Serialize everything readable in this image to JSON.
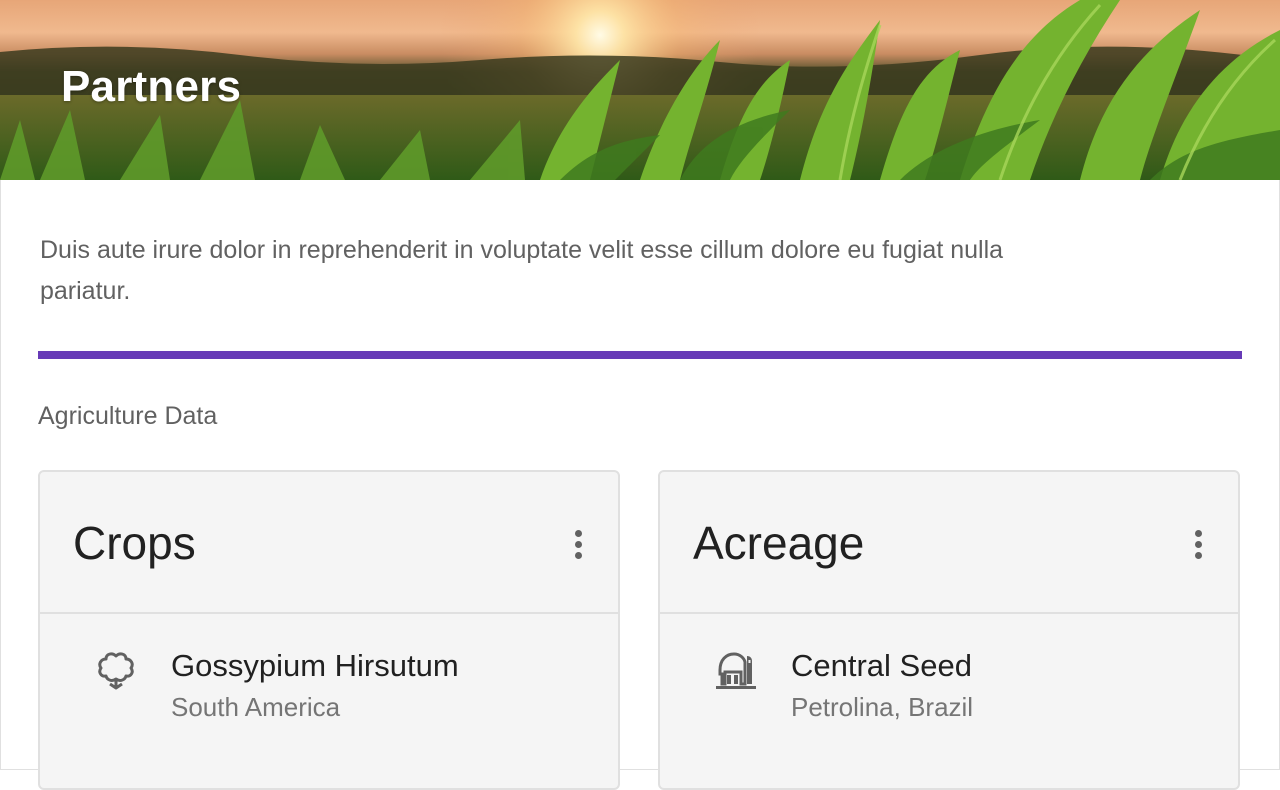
{
  "header": {
    "title": "Partners"
  },
  "intro": {
    "text": "Duis aute irure dolor in reprehenderit in voluptate velit esse cillum dolore eu fugiat nulla pariatur."
  },
  "accent_color": "#673ab7",
  "section": {
    "label": "Agriculture Data"
  },
  "cards": [
    {
      "title": "Crops",
      "menu_icon": "more-vert-icon",
      "item": {
        "icon": "cotton-icon",
        "primary": "Gossypium Hirsutum",
        "secondary": "South America"
      }
    },
    {
      "title": "Acreage",
      "menu_icon": "more-vert-icon",
      "item": {
        "icon": "barn-icon",
        "primary": "Central Seed",
        "secondary": "Petrolina, Brazil"
      }
    }
  ]
}
